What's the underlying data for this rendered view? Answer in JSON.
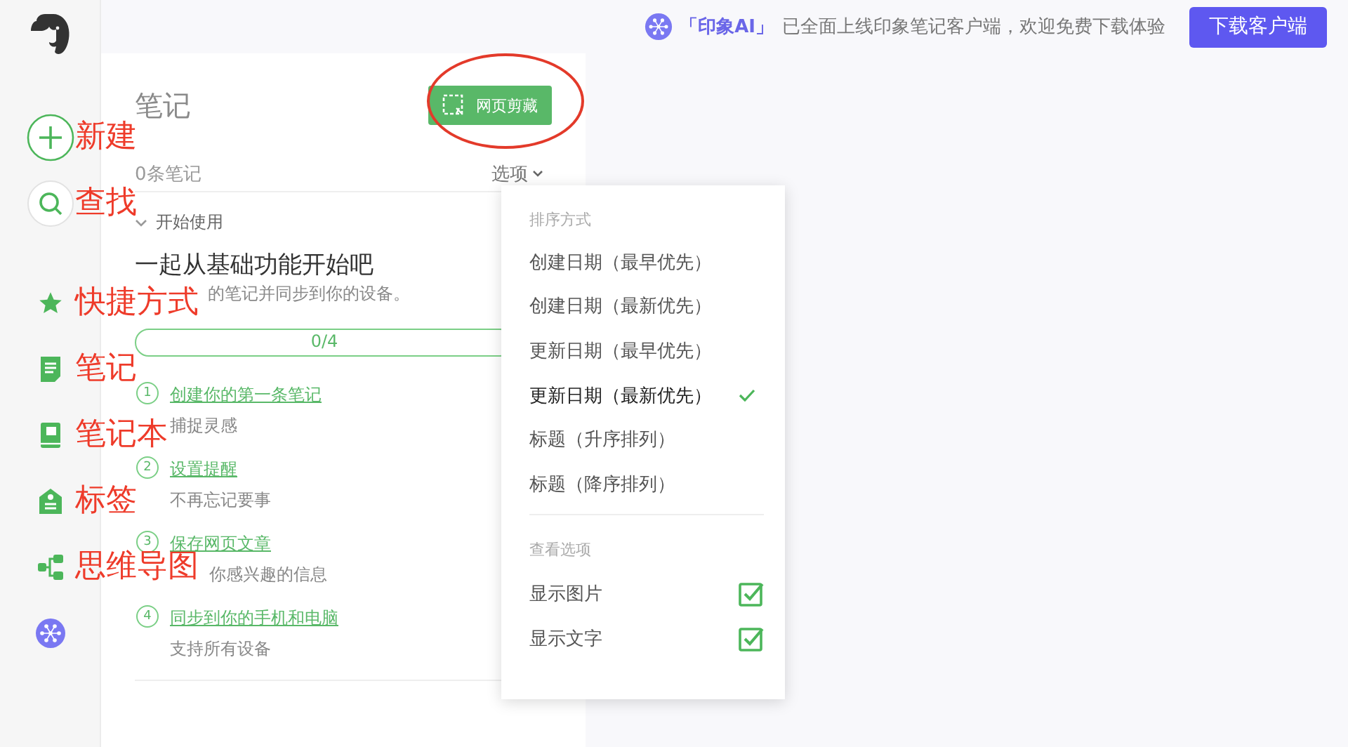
{
  "banner": {
    "brand": "「印象AI」",
    "message": "已全面上线印象笔记客户端，欢迎免费下载体验",
    "button": "下载客户端"
  },
  "sidebar": {
    "items": [
      {
        "kind": "new",
        "annotation": "新建"
      },
      {
        "kind": "search",
        "annotation": "查找"
      },
      {
        "kind": "shortcuts",
        "annotation": "快捷方式"
      },
      {
        "kind": "notes",
        "annotation": "笔记"
      },
      {
        "kind": "notebooks",
        "annotation": "笔记本"
      },
      {
        "kind": "tags",
        "annotation": "标签"
      },
      {
        "kind": "mindmap",
        "annotation": "思维导图"
      },
      {
        "kind": "ai"
      }
    ]
  },
  "notes": {
    "title": "笔记",
    "clip_button": "网页剪藏",
    "clip_button_circled": true,
    "count": "0条笔记",
    "options": "选项",
    "section": {
      "title": "开始使用",
      "expanded": true,
      "heading": "一起从基础功能开始吧",
      "description": "的笔记并同步到你的设备。",
      "description_covered": true,
      "progress": {
        "label": "0/4",
        "level": 0
      },
      "steps": [
        {
          "number": "1",
          "link": "创建你的第一条笔记",
          "hint": "捕捉灵感",
          "covered": false
        },
        {
          "number": "2",
          "link": "设置提醒",
          "hint": "不再忘记要事",
          "covered": false
        },
        {
          "number": "3",
          "link": "保存网页文章",
          "hint": "你感兴趣的信息",
          "covered": true
        },
        {
          "number": "4",
          "link": "同步到你的手机和电脑",
          "hint": "支持所有设备",
          "covered": false
        }
      ]
    }
  },
  "menu": {
    "sort_header": "排序方式",
    "sort_options": [
      {
        "label": "创建日期（最早优先）",
        "selected": false
      },
      {
        "label": "创建日期（最新优先）",
        "selected": false
      },
      {
        "label": "更新日期（最早优先）",
        "selected": false
      },
      {
        "label": "更新日期（最新优先）",
        "selected": true
      },
      {
        "label": "标题（升序排列）",
        "selected": false
      },
      {
        "label": "标题（降序排列）",
        "selected": false
      }
    ],
    "view_header": "查看选项",
    "view_options": [
      {
        "label": "显示图片",
        "checked": true
      },
      {
        "label": "显示文字",
        "checked": true
      }
    ]
  }
}
